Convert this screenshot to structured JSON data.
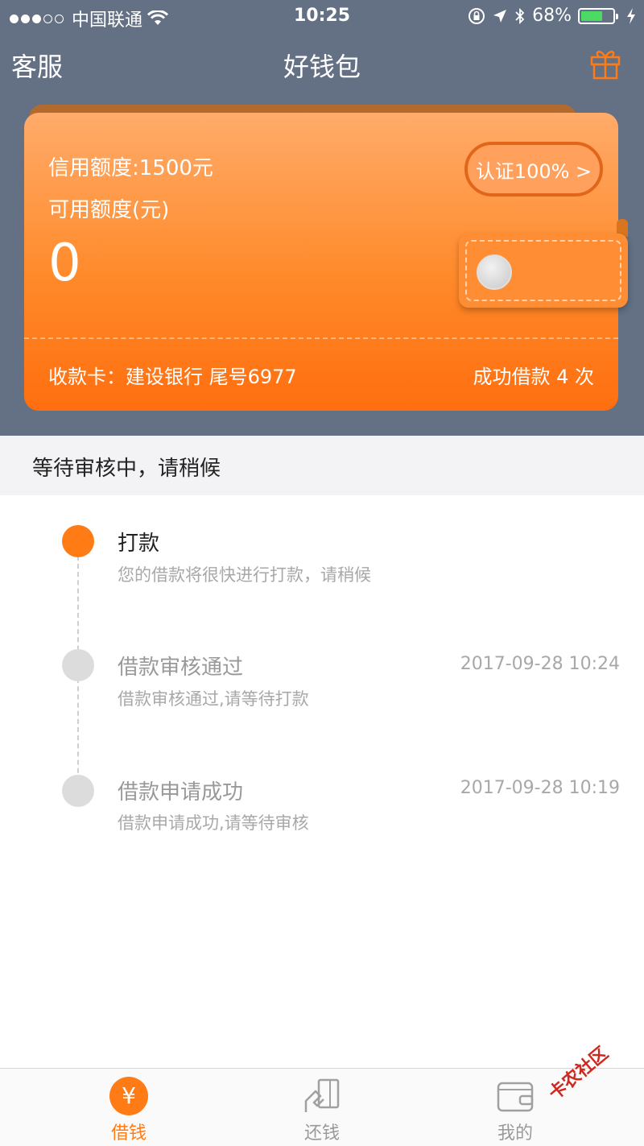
{
  "status_bar": {
    "carrier": "中国联通",
    "time": "10:25",
    "battery": "68%",
    "battery_level": 0.68
  },
  "nav": {
    "left": "客服",
    "title": "好钱包",
    "gift_icon": "gift-icon"
  },
  "card": {
    "credit_limit": "信用额度:1500元",
    "available_label": "可用额度(元)",
    "available_amount": "0",
    "verify_label": "认证100% >",
    "bank_card": "收款卡：建设银行 尾号6977",
    "success_count": "成功借款 4 次"
  },
  "banner": {
    "text": "等待审核中，请稍候"
  },
  "timeline": [
    {
      "title": "打款",
      "desc": "您的借款将很快进行打款，请稍候",
      "time": "",
      "active": true
    },
    {
      "title": "借款审核通过",
      "desc": "借款审核通过,请等待打款",
      "time": "2017-09-28 10:24",
      "active": false
    },
    {
      "title": "借款申请成功",
      "desc": "借款申请成功,请等待审核",
      "time": "2017-09-28 10:19",
      "active": false
    }
  ],
  "tabbar": {
    "borrow": {
      "label": "借钱",
      "icon": "yen-icon"
    },
    "repay": {
      "label": "还钱",
      "icon": "card-hand-icon"
    },
    "mine": {
      "label": "我的",
      "icon": "wallet-icon"
    }
  },
  "watermark": "卡农社区",
  "colors": {
    "header_bg": "#647083",
    "accent": "#ff7b15",
    "banner_bg": "#f3f3f5"
  }
}
